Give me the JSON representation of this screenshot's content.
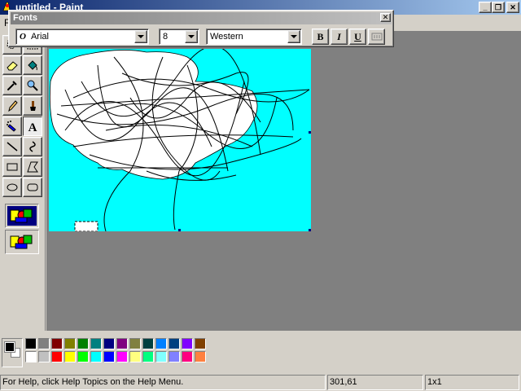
{
  "window": {
    "title": "untitled - Paint",
    "minimize_glyph": "_",
    "maximize_glyph": "❐",
    "close_glyph": "✕"
  },
  "menubar": {
    "first_item_label": "F"
  },
  "fonts_toolbar": {
    "title": "Fonts",
    "close_glyph": "✕",
    "font_glyph": "O",
    "font_name": "Arial",
    "font_size": "8",
    "script": "Western",
    "bold_label": "B",
    "italic_label": "I",
    "underline_label": "U"
  },
  "tools": [
    "free-form-select",
    "select",
    "eraser",
    "fill-with-color",
    "pick-color",
    "magnifier",
    "pencil",
    "brush",
    "airbrush",
    "text",
    "line",
    "curve",
    "rectangle",
    "polygon",
    "ellipse",
    "rounded-rectangle"
  ],
  "selected_tool": "text",
  "palette": {
    "foreground": "#000000",
    "background": "#ffffff",
    "colors_row1": [
      "#000000",
      "#808080",
      "#800000",
      "#808000",
      "#008000",
      "#008080",
      "#000080",
      "#800080",
      "#808040",
      "#004040",
      "#0080ff",
      "#004080",
      "#8000ff",
      "#804000"
    ],
    "colors_row2": [
      "#ffffff",
      "#c0c0c0",
      "#ff0000",
      "#ffff00",
      "#00ff00",
      "#00ffff",
      "#0000ff",
      "#ff00ff",
      "#ffff80",
      "#00ff80",
      "#80ffff",
      "#8080ff",
      "#ff0080",
      "#ff8040"
    ]
  },
  "canvas": {
    "background_color": "#00ffff",
    "cloud_color": "#ffffff"
  },
  "status": {
    "help": "For Help, click Help Topics on the Help Menu.",
    "coordinates": "301,61",
    "selection_size": "1x1"
  }
}
